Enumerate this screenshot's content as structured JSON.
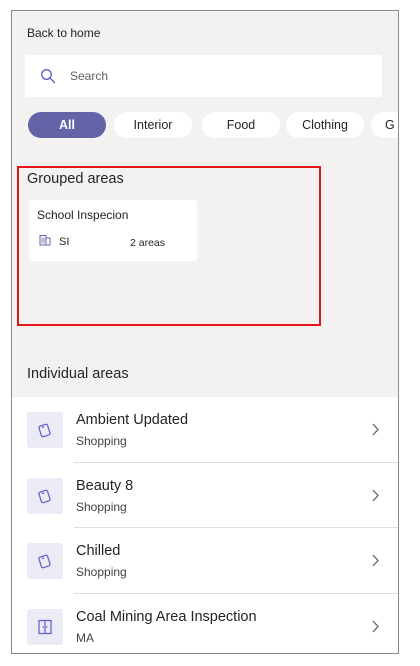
{
  "nav": {
    "back_label": "Back to home"
  },
  "search": {
    "placeholder": "Search"
  },
  "filters": [
    {
      "label": "All",
      "active": true
    },
    {
      "label": "Interior",
      "active": false
    },
    {
      "label": "Food",
      "active": false
    },
    {
      "label": "Clothing",
      "active": false
    },
    {
      "label": "G",
      "active": false
    }
  ],
  "grouped": {
    "title": "Grouped areas",
    "cards": [
      {
        "name": "School Inspecion",
        "abbr": "SI",
        "count": "2 areas",
        "icon": "building-icon"
      }
    ]
  },
  "individual": {
    "title": "Individual areas",
    "items": [
      {
        "title": "Ambient Updated",
        "subtitle": "Shopping",
        "icon": "shopping-tag-icon"
      },
      {
        "title": "Beauty 8",
        "subtitle": "Shopping",
        "icon": "shopping-tag-icon"
      },
      {
        "title": "Chilled",
        "subtitle": "Shopping",
        "icon": "shopping-tag-icon"
      },
      {
        "title": "Coal Mining Area Inspection",
        "subtitle": "MA",
        "icon": "door-icon"
      }
    ]
  },
  "colors": {
    "accent": "#6264a7",
    "panel_bg": "#f3f2f1",
    "highlight": "#e3161b",
    "icon_tile": "#ebebf5"
  }
}
